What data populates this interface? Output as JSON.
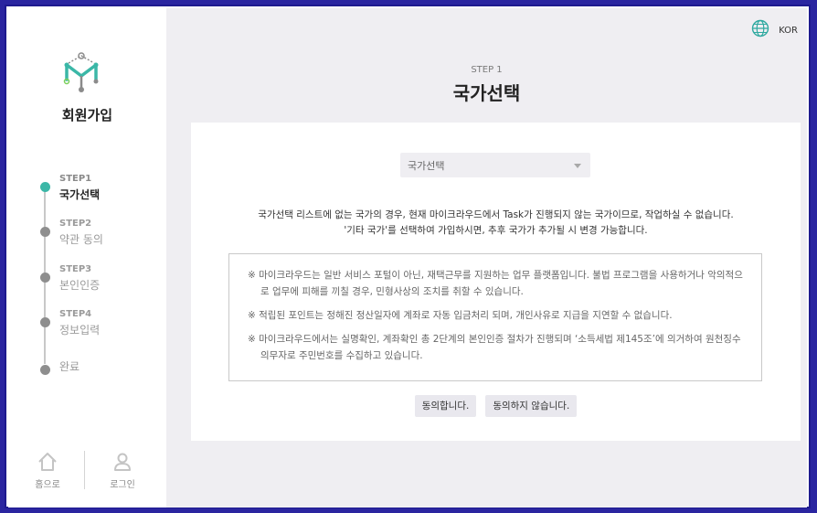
{
  "sidebar": {
    "title": "회원가입",
    "steps": [
      {
        "num": "STEP1",
        "name": "국가선택"
      },
      {
        "num": "STEP2",
        "name": "약관 동의"
      },
      {
        "num": "STEP3",
        "name": "본인인증"
      },
      {
        "num": "STEP4",
        "name": "정보입력"
      },
      {
        "num": "",
        "name": "완료"
      }
    ],
    "bottom_nav": {
      "home_label": "홈으로",
      "login_label": "로그인"
    }
  },
  "header": {
    "language": "KOR",
    "step_label": "STEP 1",
    "title": "국가선택"
  },
  "country_select": {
    "value": "국가선택"
  },
  "description": [
    "국가선택 리스트에 없는 국가의 경우, 현재 마이크라우드에서 Task가 진행되지 않는 국가이므로, 작업하실 수 없습니다.",
    "'기타 국가'를 선택하여 가입하시면, 추후 국가가 추가될 시 변경 가능합니다."
  ],
  "notices": [
    "※ 마이크라우드는 일반 서비스 포털이 아닌, 재택근무를 지원하는 업무 플랫폼입니다. 불법 프로그램을 사용하거나 악의적으로 업무에 피해를 끼칠 경우, 민형사상의 조치를 취할 수 있습니다.",
    "※ 적립된 포인트는 정해진 정산일자에 계좌로 자동 입금처리 되며, 개인사유로 지급을 지연할 수 없습니다.",
    "※ 마이크라우드에서는 실명확인, 계좌확인 총 2단계의 본인인증 절차가 진행되며 ‘소득세법 제145조’에 의거하여 원천징수의무자로 주민번호를 수집하고 있습니다."
  ],
  "buttons": {
    "agree": "동의합니다.",
    "disagree": "동의하지 않습니다."
  },
  "colors": {
    "accent": "#3bb7a7",
    "frame": "#2a25a0",
    "main_bg": "#efeef2"
  }
}
